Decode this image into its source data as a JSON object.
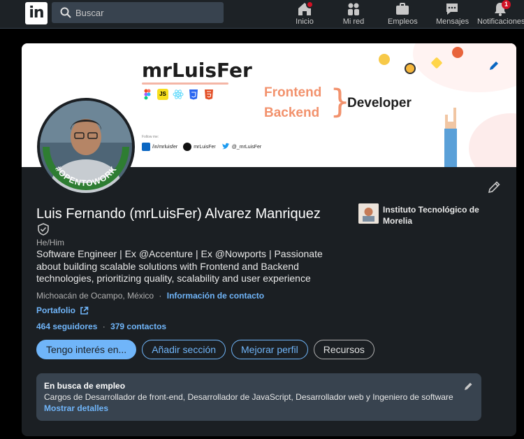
{
  "nav": {
    "logo": "in",
    "search_placeholder": "Buscar",
    "items": [
      {
        "label": "Inicio",
        "icon": "home-icon",
        "badge": ""
      },
      {
        "label": "Mi red",
        "icon": "network-icon",
        "badge": ""
      },
      {
        "label": "Empleos",
        "icon": "briefcase-icon",
        "badge": ""
      },
      {
        "label": "Mensajes",
        "icon": "chat-icon",
        "badge": ""
      },
      {
        "label": "Notificaciones",
        "icon": "bell-icon",
        "badge": "1"
      }
    ]
  },
  "banner": {
    "brand": "mrLuisFer",
    "tech_badges": [
      "figma-icon",
      "js-icon",
      "react-icon",
      "css3-icon",
      "html5-icon"
    ],
    "js_label": "JS",
    "role_line1": "Frontend",
    "role_line2": "Backend",
    "role_suffix": "Developer",
    "follow_label": "Follow me:",
    "socials": [
      {
        "icon": "linkedin-icon",
        "handle": "/in/mrluisfer"
      },
      {
        "icon": "github-icon",
        "handle": "mrLuisFer"
      },
      {
        "icon": "twitter-icon",
        "handle": "@_mrLuisFer"
      }
    ]
  },
  "avatar": {
    "ring_text": "#OPENTOWORK"
  },
  "profile": {
    "name": "Luis Fernando (mrLuisFer) Alvarez Manriquez",
    "pronouns": "He/Him",
    "headline": "Software Engineer | Ex @Accenture | Ex @Nowports | Passionate about building scalable solutions with Frontend and Backend technologies, prioritizing quality, scalability and user experience",
    "location": "Michoacán de Ocampo, México",
    "location_sep": "·",
    "contact_link": "Información de contacto",
    "portfolio": "Portafolio",
    "followers": "464 seguidores",
    "stats_sep": "·",
    "connections": "379 contactos"
  },
  "education": {
    "name": "Instituto Tecnológico de Morelia"
  },
  "actions": {
    "open_to": "Tengo interés en...",
    "add_section": "Añadir sección",
    "enhance": "Mejorar perfil",
    "resources": "Recursos"
  },
  "open_to_work": {
    "title": "En busca de empleo",
    "description": "Cargos de Desarrollador de front-end, Desarrollador de JavaScript, Desarrollador web y Ingeniero de software",
    "link": "Mostrar detalles"
  },
  "colors": {
    "accent": "#70b5f9",
    "nav_bg": "#1d2226",
    "card_bg": "#1b1f23",
    "open_to_work_green": "#2e7d32",
    "banner_accent": "#f2926d"
  }
}
